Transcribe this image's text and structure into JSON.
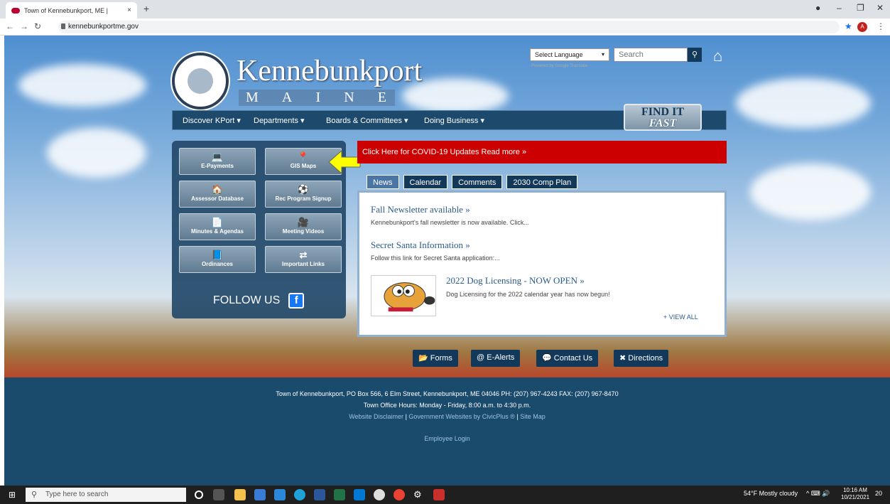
{
  "browser": {
    "tab_title": "Town of Kennebunkport, ME |",
    "tab_close": "×",
    "new_tab": "+",
    "url": "kennebunkportme.gov",
    "profile_initial": "A"
  },
  "header": {
    "title": "Kennebunkport",
    "subtitle_letters": [
      "M",
      "A",
      "I",
      "N",
      "E"
    ],
    "language_select": "Select Language",
    "powered_by": "Powered by Google Translate",
    "search_placeholder": "Search"
  },
  "nav": {
    "items": [
      "Discover KPort ▾",
      "Departments ▾",
      "Boards & Committees ▾",
      "Doing Business ▾"
    ],
    "find_it": "FIND IT",
    "fast": "FAST"
  },
  "quick_links": {
    "items": [
      {
        "label": "E-Payments",
        "icon": "laptop-icon",
        "glyph": "💻"
      },
      {
        "label": "GIS Maps",
        "icon": "map-pin-icon",
        "glyph": "📍"
      },
      {
        "label": "Assessor Database",
        "icon": "house-icon",
        "glyph": "🏠"
      },
      {
        "label": "Rec Program Signup",
        "icon": "soccer-ball-icon",
        "glyph": "⚽"
      },
      {
        "label": "Minutes & Agendas",
        "icon": "document-icon",
        "glyph": "📄"
      },
      {
        "label": "Meeting Videos",
        "icon": "video-camera-icon",
        "glyph": "🎥"
      },
      {
        "label": "Ordinances",
        "icon": "book-icon",
        "glyph": "📘"
      },
      {
        "label": "Important Links",
        "icon": "arrows-icon",
        "glyph": "⇄"
      }
    ],
    "follow_us": "FOLLOW US",
    "facebook": "f"
  },
  "alert": {
    "covid_text": "Click Here for COVID-19 Updates Read more »"
  },
  "news_tabs": [
    "News",
    "Calendar",
    "Comments",
    "2030 Comp Plan"
  ],
  "news": {
    "items": [
      {
        "title": "Fall Newsletter available »",
        "desc": "Kennebunkport's fall newsletter is now available. Click..."
      },
      {
        "title": "Secret Santa Information  »",
        "desc": "Follow this link for Secret Santa application:..."
      },
      {
        "title": "2022 Dog Licensing - NOW OPEN »",
        "desc": "Dog Licensing for the 2022 calendar year has now begun!"
      }
    ],
    "view_all": "+ VIEW ALL"
  },
  "bottom_links": [
    "Forms",
    "E-Alerts",
    "Contact Us",
    "Directions"
  ],
  "footer": {
    "address": "Town of Kennebunkport, PO Box 566, 6 Elm Street, Kennebunkport, ME 04046  PH: (207) 967-4243  FAX: (207) 967-8470",
    "hours": "Town Office Hours:  Monday - Friday, 8:00 a.m. to 4:30 p.m.",
    "disclaimer": "Website Disclaimer",
    "civicplus": "Government Websites by CivicPlus ®",
    "sitemap": "Site Map",
    "employee_login": "Employee Login"
  },
  "taskbar": {
    "search_placeholder": "Type here to search",
    "weather": "54°F  Mostly cloudy",
    "time": "10:16 AM",
    "date": "10/21/2021",
    "notif": "20"
  },
  "colors": {
    "nav_blue": "#1d4a6c",
    "alert_red": "#cc0000",
    "arrow_yellow": "#ffff00"
  }
}
